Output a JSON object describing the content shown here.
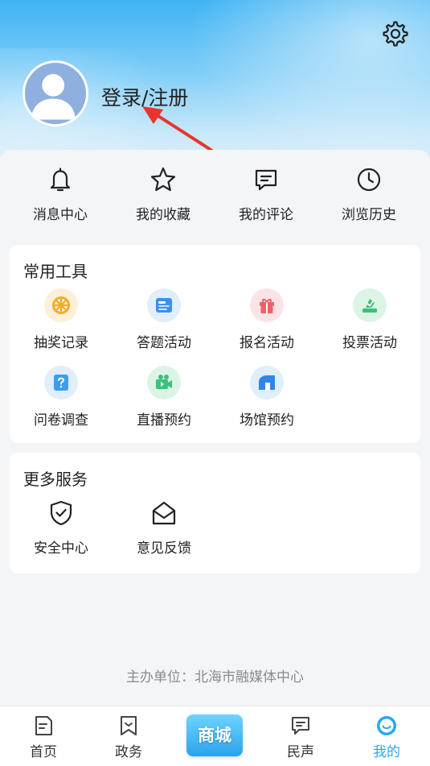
{
  "header": {
    "login_label": "登录/注册",
    "settings_icon": "gear-icon",
    "avatar_icon": "default-avatar-icon"
  },
  "quick_links": [
    {
      "label": "消息中心",
      "icon": "bell-icon"
    },
    {
      "label": "我的收藏",
      "icon": "star-icon"
    },
    {
      "label": "我的评论",
      "icon": "comment-icon"
    },
    {
      "label": "浏览历史",
      "icon": "clock-icon"
    }
  ],
  "tools": {
    "title": "常用工具",
    "items": [
      {
        "label": "抽奖记录",
        "icon": "lottery-wheel-icon",
        "color": "#f7a928"
      },
      {
        "label": "答题活动",
        "icon": "quiz-card-icon",
        "color": "#3b8ff0"
      },
      {
        "label": "报名活动",
        "icon": "gift-icon",
        "color": "#f0606a"
      },
      {
        "label": "投票活动",
        "icon": "vote-box-icon",
        "color": "#3cc07a"
      },
      {
        "label": "问卷调查",
        "icon": "question-icon",
        "color": "#3b9ef0"
      },
      {
        "label": "直播预约",
        "icon": "video-camera-icon",
        "color": "#3cc07a"
      },
      {
        "label": "场馆预约",
        "icon": "venue-icon",
        "color": "#2f86e8"
      }
    ]
  },
  "services": {
    "title": "更多服务",
    "items": [
      {
        "label": "安全中心",
        "icon": "shield-check-icon"
      },
      {
        "label": "意见反馈",
        "icon": "envelope-open-icon"
      }
    ]
  },
  "sponsor": "主办单位：北海市融媒体中心",
  "tabbar": {
    "home": "首页",
    "politics": "政务",
    "mall": "商城",
    "voice": "民声",
    "mine": "我的",
    "active_color": "#2aa8ec"
  }
}
